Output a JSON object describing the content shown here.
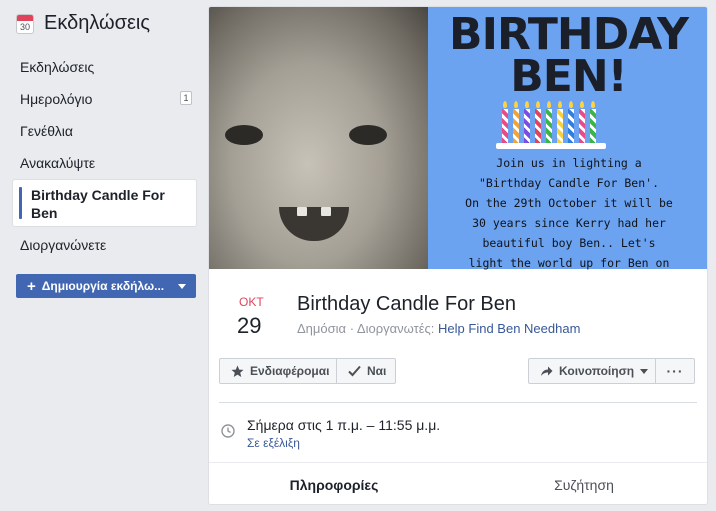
{
  "sidebar": {
    "calendar_icon_day": "30",
    "title": "Εκδηλώσεις",
    "items": [
      {
        "label": "Εκδηλώσεις"
      },
      {
        "label": "Ημερολόγιο",
        "badge": "1"
      },
      {
        "label": "Γενέθλια"
      },
      {
        "label": "Ανακαλύψτε"
      },
      {
        "label": "Birthday Candle For Ben",
        "active": true
      },
      {
        "label": "Διοργανώνετε"
      }
    ],
    "create_button": "Δημιουργία εκδήλωσης",
    "create_button_display": "Δημιουργία εκδήλω..."
  },
  "cover": {
    "poster_line1": "BIRTHDAY",
    "poster_line2": "BEN!",
    "poster_text": "Join us in lighting a\n\"Birthday Candle For Ben'.\nOn the 29th October it will be\n30 years since Kerry had her\nbeautiful boy Ben.. Let's\nlight the world up for Ben on"
  },
  "event": {
    "month": "ΟΚΤ",
    "day": "29",
    "title": "Birthday Candle For Ben",
    "privacy": "Δημόσια",
    "organizers_label": "Διοργανωτές:",
    "organizer": "Help Find Ben Needham"
  },
  "actions": {
    "interested": "Ενδιαφέρομαι",
    "going": "Ναι",
    "share": "Κοινοποίηση",
    "more": "···"
  },
  "time": {
    "main": "Σήμερα στις 1 π.μ. – 11:55 μ.μ.",
    "status": "Σε εξέλιξη"
  },
  "tabs": [
    {
      "label": "Πληροφορίες",
      "active": true
    },
    {
      "label": "Συζήτηση"
    }
  ],
  "colors": {
    "accent": "#4267b2",
    "link": "#385898",
    "date_red": "#e0445c",
    "poster_bg": "#6ba3f0"
  }
}
